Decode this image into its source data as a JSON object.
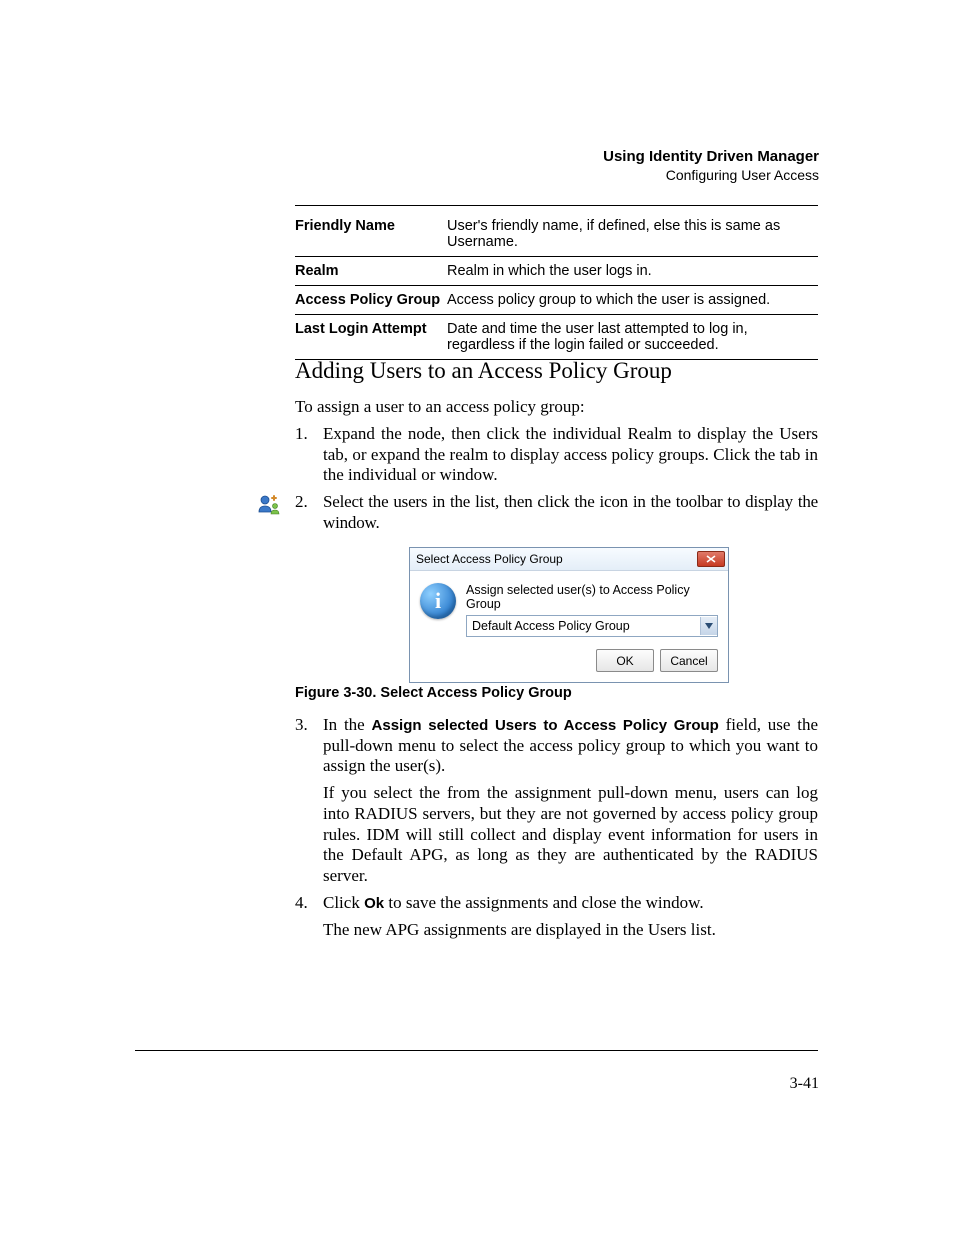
{
  "header": {
    "title": "Using Identity Driven Manager",
    "subtitle": "Configuring User Access"
  },
  "defs": [
    {
      "term": "Friendly Name",
      "desc": "User's friendly name, if defined, else this is same as Username."
    },
    {
      "term": "Realm",
      "desc": "Realm in which the user logs in."
    },
    {
      "term": "Access Policy Group",
      "desc": "Access policy group to which the user is assigned."
    },
    {
      "term": "Last Login Attempt",
      "desc": "Date and time the user last attempted to log in, regardless if the login failed or succeeded."
    }
  ],
  "section_heading": "Adding Users to an Access Policy Group",
  "intro": "To assign a user to an access policy group:",
  "step1": {
    "num": "1.",
    "a": "Expand the ",
    "b": " node, then click the individual Realm to display the Users tab, or expand the realm to display access policy groups. Click the ",
    "c": " tab in the individual ",
    "d": " or ",
    "e": " window."
  },
  "step2": {
    "num": "2.",
    "a": "Select the users in the list, then click the ",
    "b": " icon in the toolbar to display the ",
    "c": " window."
  },
  "dialog": {
    "title": "Select Access Policy Group",
    "label": "Assign selected user(s) to Access Policy Group",
    "value": "Default Access Policy Group",
    "ok": "OK",
    "cancel": "Cancel"
  },
  "figure_caption": "Figure 3-30. Select Access Policy Group",
  "step3": {
    "num": "3.",
    "a": "In the ",
    "bold": "Assign selected Users to Access Policy Group",
    "b": "  field, use the pull-down menu to select the access policy group to which you want to assign the user(s).",
    "p2a": "If you select the ",
    "p2b": " from the assignment pull-down menu, users can log into RADIUS servers, but they are not governed by access policy group rules. IDM will still collect and display event information for users in the Default APG, as long as they are authenticated by the RADIUS server."
  },
  "step4": {
    "num": "4.",
    "a": "Click ",
    "bold": "Ok",
    "b": " to save the assignments and close the window.",
    "p2": "The new APG assignments are displayed in the Users list."
  },
  "pagenum": "3-41"
}
